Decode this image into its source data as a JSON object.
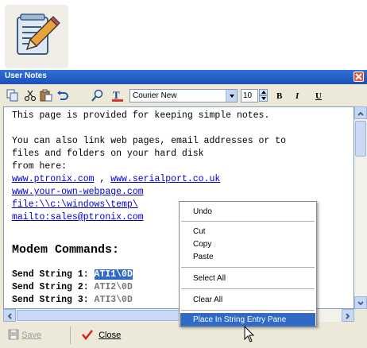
{
  "app_icon": {
    "icon": "notepad-pencil-icon"
  },
  "window": {
    "title": "User Notes"
  },
  "toolbar": {
    "icons": [
      "copy-icon",
      "cut-icon",
      "paste-icon",
      "undo-icon",
      "find-icon",
      "font-color-icon"
    ],
    "font_name": "Courier New",
    "font_size": "10",
    "bold_label": "B",
    "italic_label": "I",
    "underline_label": "U"
  },
  "editor": {
    "line1": "This page is provided for keeping simple notes.",
    "line2": "You can also link web pages, email addresses or to",
    "line3": "files and folders on your hard disk",
    "line4": "from here:",
    "link1": "www.ptronix.com",
    "link_sep": " , ",
    "link2": "www.serialport.co.uk",
    "link3": "www.your-own-webpage.com",
    "link4": "file:\\\\c:\\windows\\temp\\",
    "link5": "mailto:sales@ptronix.com",
    "heading": "Modem Commands:",
    "cmd_label": "Send String 1: ",
    "cmd1": "ATI1\\0D",
    "cmd_label2": "Send String 2: ",
    "cmd2": "ATI2\\0D",
    "cmd_label3": "Send String 3: ",
    "cmd3": "ATI3\\0D"
  },
  "context_menu": {
    "undo": "Undo",
    "cut": "Cut",
    "copy": "Copy",
    "paste": "Paste",
    "select_all": "Select All",
    "clear_all": "Clear All",
    "place": "Place In String Entry Pane"
  },
  "bottom": {
    "save_label": "Save",
    "close_label": "Close"
  },
  "colors": {
    "titlebar": "#2f72d8",
    "link": "#0000cc",
    "selection": "#316ac5"
  }
}
